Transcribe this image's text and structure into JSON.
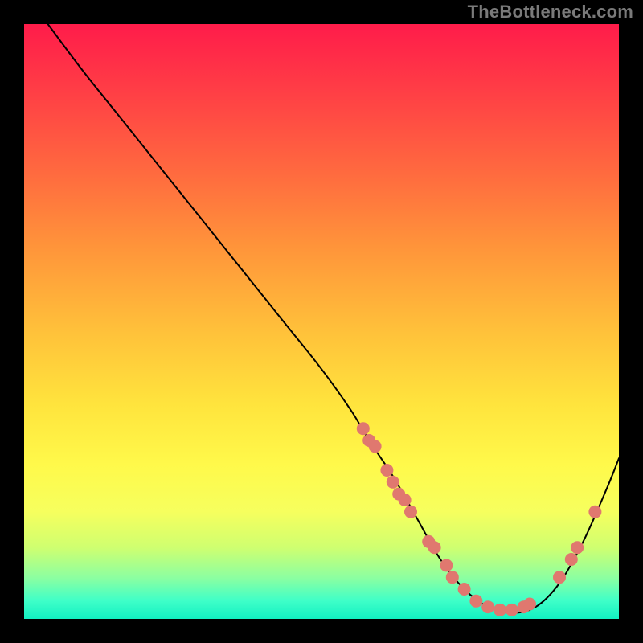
{
  "watermark": "TheBottleneck.com",
  "chart_data": {
    "type": "line",
    "title": "",
    "xlabel": "",
    "ylabel": "",
    "xlim": [
      0,
      100
    ],
    "ylim": [
      0,
      100
    ],
    "grid": false,
    "legend": false,
    "series": [
      {
        "name": "curve",
        "x": [
          4,
          10,
          18,
          26,
          34,
          42,
          50,
          55,
          58,
          62,
          66,
          70,
          74,
          78,
          82,
          86,
          90,
          94,
          98,
          100
        ],
        "y": [
          100,
          92,
          82,
          72,
          62,
          52,
          42,
          35,
          30,
          24,
          17,
          10,
          5,
          2,
          1,
          2,
          6,
          13,
          22,
          27
        ],
        "stroke": "#000000",
        "width": 2
      }
    ],
    "scatter": [
      {
        "name": "dots",
        "points": [
          {
            "x": 57,
            "y": 32
          },
          {
            "x": 58,
            "y": 30
          },
          {
            "x": 59,
            "y": 29
          },
          {
            "x": 61,
            "y": 25
          },
          {
            "x": 62,
            "y": 23
          },
          {
            "x": 63,
            "y": 21
          },
          {
            "x": 64,
            "y": 20
          },
          {
            "x": 65,
            "y": 18
          },
          {
            "x": 68,
            "y": 13
          },
          {
            "x": 69,
            "y": 12
          },
          {
            "x": 71,
            "y": 9
          },
          {
            "x": 72,
            "y": 7
          },
          {
            "x": 74,
            "y": 5
          },
          {
            "x": 76,
            "y": 3
          },
          {
            "x": 78,
            "y": 2
          },
          {
            "x": 80,
            "y": 1.5
          },
          {
            "x": 82,
            "y": 1.5
          },
          {
            "x": 84,
            "y": 2
          },
          {
            "x": 85,
            "y": 2.5
          },
          {
            "x": 90,
            "y": 7
          },
          {
            "x": 92,
            "y": 10
          },
          {
            "x": 93,
            "y": 12
          },
          {
            "x": 96,
            "y": 18
          }
        ],
        "fill": "#e0786f",
        "r": 8
      }
    ],
    "gradient_stops": [
      {
        "pos": 0,
        "color": "#ff1c4a"
      },
      {
        "pos": 25,
        "color": "#ff6a3f"
      },
      {
        "pos": 52,
        "color": "#ffc23a"
      },
      {
        "pos": 74,
        "color": "#fff94a"
      },
      {
        "pos": 93,
        "color": "#8dffa0"
      },
      {
        "pos": 100,
        "color": "#12f0c2"
      }
    ]
  }
}
